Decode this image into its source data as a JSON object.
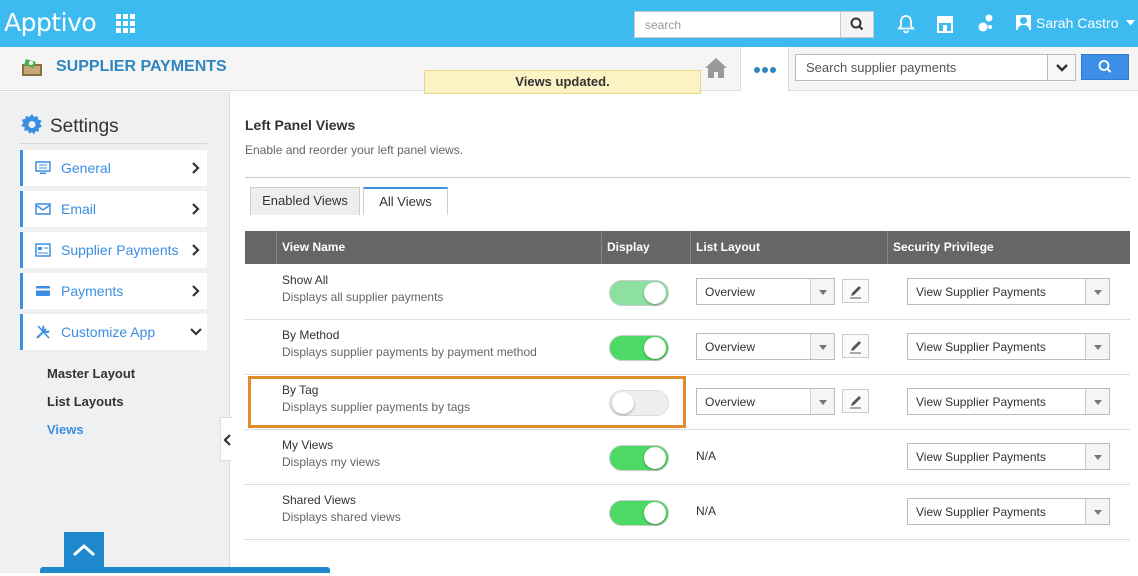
{
  "topbar": {
    "logo": "Apptivo",
    "search_placeholder": "search",
    "user_name": "Sarah Castro",
    "icons": [
      "apps-grid-icon",
      "search-icon",
      "bell-icon",
      "store-icon",
      "user-network-icon",
      "user-avatar-icon",
      "caret-down-icon"
    ]
  },
  "subheader": {
    "title": "SUPPLIER PAYMENTS",
    "toast": "Views updated.",
    "search_placeholder": "Search supplier payments"
  },
  "sidebar": {
    "title": "Settings",
    "items": [
      {
        "label": "General",
        "icon": "monitor-icon"
      },
      {
        "label": "Email",
        "icon": "envelope-icon"
      },
      {
        "label": "Supplier Payments",
        "icon": "card-list-icon"
      },
      {
        "label": "Payments",
        "icon": "credit-card-icon"
      },
      {
        "label": "Customize App",
        "icon": "tools-icon"
      }
    ],
    "sub_items": [
      "Master Layout",
      "List Layouts",
      "Views"
    ],
    "active_sub": "Views"
  },
  "content": {
    "heading": "Left Panel Views",
    "description": "Enable and reorder your left panel views.",
    "tabs": [
      "Enabled Views",
      "All Views"
    ],
    "active_tab": "All Views",
    "columns": [
      "View Name",
      "Display",
      "List Layout",
      "Security Privilege"
    ],
    "rows": [
      {
        "name": "Show All",
        "desc": "Displays all supplier payments",
        "display": "on",
        "layout": "Overview",
        "privilege": "View Supplier Payments"
      },
      {
        "name": "By Method",
        "desc": "Displays supplier payments by payment method",
        "display": "on",
        "layout": "Overview",
        "privilege": "View Supplier Payments"
      },
      {
        "name": "By Tag",
        "desc": "Displays supplier payments by tags",
        "display": "off",
        "layout": "Overview",
        "privilege": "View Supplier Payments"
      },
      {
        "name": "My Views",
        "desc": "Displays my views",
        "display": "on",
        "layout": "N/A",
        "privilege": "View Supplier Payments"
      },
      {
        "name": "Shared Views",
        "desc": "Displays shared views",
        "display": "on",
        "layout": "N/A",
        "privilege": "View Supplier Payments"
      }
    ]
  },
  "colors": {
    "topbar": "#3dbbf1",
    "accent": "#3b8fe0",
    "toggle_on": "#4cd964",
    "highlight": "#e08c2c",
    "table_header": "#666666"
  }
}
